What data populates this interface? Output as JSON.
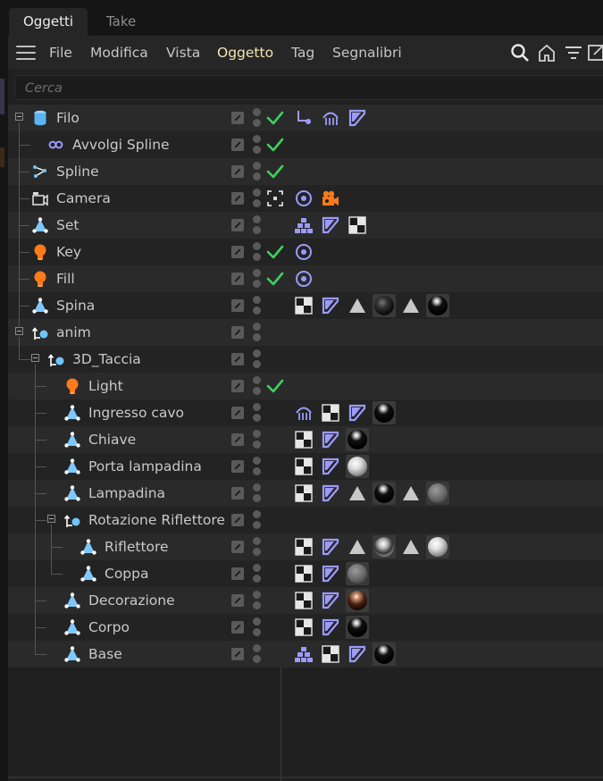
{
  "tabs": [
    {
      "label": "Oggetti",
      "active": true
    },
    {
      "label": "Take",
      "active": false
    }
  ],
  "menu": {
    "items": [
      {
        "label": "File"
      },
      {
        "label": "Modifica"
      },
      {
        "label": "Vista"
      },
      {
        "label": "Oggetto",
        "highlighted": true
      },
      {
        "label": "Tag"
      },
      {
        "label": "Segnalibri"
      }
    ],
    "icons": [
      "search-icon",
      "home-icon",
      "filter-icon",
      "new-window-icon"
    ]
  },
  "search": {
    "placeholder": "Cerca"
  },
  "colors": {
    "accent_check": "#3fd15f",
    "tag_purple": "#8d8dff",
    "light_orange": "#ff7a1a",
    "null_blue": "#6ec6ff",
    "menu_highlight": "#f0e4b0"
  },
  "objects": [
    {
      "name": "Filo",
      "depth": 0,
      "icon": "cylinder-icon",
      "expand": "minus",
      "check": true,
      "tags": [
        "spline-ik-icon",
        "hair-tag-icon",
        "texture-tag-icon"
      ]
    },
    {
      "name": "Avvolgi Spline",
      "depth": 1,
      "icon": "spline-wrap-icon",
      "check": true,
      "tags": []
    },
    {
      "name": "Spline",
      "depth": 0,
      "icon": "spline-icon",
      "check": true,
      "tags": []
    },
    {
      "name": "Camera",
      "depth": 0,
      "icon": "camera-icon",
      "camera_toggle": true,
      "tags": [
        "target-tag-icon",
        "camera-tag-icon"
      ]
    },
    {
      "name": "Set",
      "depth": 0,
      "icon": "polygon-object-icon",
      "tags": [
        "pyramid-tag-icon",
        "texture-tag-icon",
        "checker-tag-icon"
      ]
    },
    {
      "name": "Key",
      "depth": 0,
      "icon": "light-icon",
      "check": true,
      "tags": [
        "target-tag-icon"
      ]
    },
    {
      "name": "Fill",
      "depth": 0,
      "icon": "light-icon",
      "check": true,
      "tags": [
        "target-tag-icon"
      ]
    },
    {
      "name": "Spina",
      "depth": 0,
      "icon": "polygon-object-icon",
      "tags": [
        "checker-tag-icon",
        "texture-tag-icon",
        "selection-tag-icon",
        "material-black",
        "selection-tag-icon",
        "material-black-gloss"
      ]
    },
    {
      "name": "anim",
      "depth": 0,
      "icon": "null-icon",
      "expand": "minus",
      "tags": []
    },
    {
      "name": "3D_Taccia",
      "depth": 1,
      "icon": "null-icon",
      "expand": "minus",
      "tags": []
    },
    {
      "name": "Light",
      "depth": 2,
      "icon": "light-icon",
      "check": true,
      "tags": []
    },
    {
      "name": "Ingresso cavo",
      "depth": 2,
      "icon": "polygon-object-icon",
      "tags": [
        "hair-tag-icon",
        "checker-tag-icon",
        "texture-tag-icon",
        "material-black-gloss"
      ]
    },
    {
      "name": "Chiave",
      "depth": 2,
      "icon": "polygon-object-icon",
      "tags": [
        "checker-tag-icon",
        "texture-tag-icon",
        "material-black-gloss"
      ]
    },
    {
      "name": "Porta lampadina",
      "depth": 2,
      "icon": "polygon-object-icon",
      "tags": [
        "checker-tag-icon",
        "texture-tag-icon",
        "material-white"
      ]
    },
    {
      "name": "Lampadina",
      "depth": 2,
      "icon": "polygon-object-icon",
      "tags": [
        "checker-tag-icon",
        "texture-tag-icon",
        "selection-tag-icon",
        "material-black-gloss",
        "selection-tag-icon",
        "material-grey-noise"
      ]
    },
    {
      "name": "Rotazione Riflettore",
      "depth": 2,
      "icon": "null-icon",
      "expand": "minus",
      "tags": []
    },
    {
      "name": "Riflettore",
      "depth": 3,
      "icon": "polygon-object-icon",
      "tags": [
        "checker-tag-icon",
        "texture-tag-icon",
        "selection-tag-icon",
        "material-chrome",
        "selection-tag-icon",
        "material-white"
      ]
    },
    {
      "name": "Coppa",
      "depth": 3,
      "icon": "polygon-object-icon",
      "tags": [
        "checker-tag-icon",
        "texture-tag-icon",
        "material-grey-noise"
      ]
    },
    {
      "name": "Decorazione",
      "depth": 2,
      "icon": "polygon-object-icon",
      "tags": [
        "checker-tag-icon",
        "texture-tag-icon",
        "material-copper"
      ]
    },
    {
      "name": "Corpo",
      "depth": 2,
      "icon": "polygon-object-icon",
      "tags": [
        "checker-tag-icon",
        "texture-tag-icon",
        "material-black-gloss"
      ]
    },
    {
      "name": "Base",
      "depth": 2,
      "icon": "polygon-object-icon",
      "tags": [
        "pyramid-tag-icon",
        "checker-tag-icon",
        "texture-tag-icon",
        "material-black-gloss"
      ]
    }
  ]
}
